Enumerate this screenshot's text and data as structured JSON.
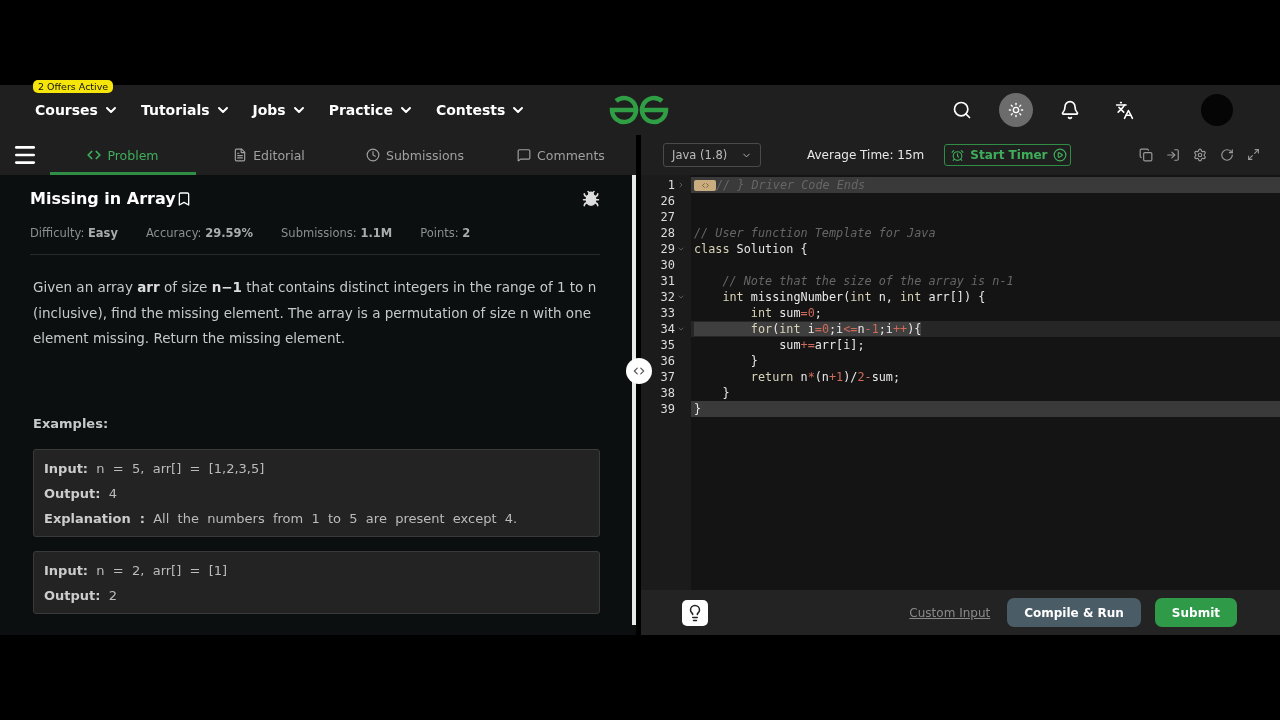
{
  "header": {
    "badge": "2 Offers Active",
    "nav": [
      {
        "label": "Courses"
      },
      {
        "label": "Tutorials"
      },
      {
        "label": "Jobs"
      },
      {
        "label": "Practice"
      },
      {
        "label": "Contests"
      }
    ],
    "theme_toggle": {
      "on": true
    }
  },
  "left_tabs": [
    {
      "label": "Problem",
      "selected": true
    },
    {
      "label": "Editorial",
      "selected": false
    },
    {
      "label": "Submissions",
      "selected": false
    },
    {
      "label": "Comments",
      "selected": false
    }
  ],
  "problem": {
    "title": "Missing in Array",
    "meta": [
      "Difficulty: **Easy**",
      "Accuracy: **29.59%**",
      "Submissions: **1.1M**",
      "Points: **2**"
    ],
    "description": "Given an array **arr** of size **n−1** that contains distinct integers in the range of 1 to n (inclusive), find the missing element. The array is a permutation of size n with one element missing. Return the missing element.",
    "examples_heading": "Examples:",
    "examples": [
      {
        "lines": [
          "**Input:**  n  =  5,  arr[]  =  [1,2,3,5]",
          "**Output:**  4",
          "**Explanation  :**  All  the  numbers  from  1  to  5  are  present  except  4."
        ]
      },
      {
        "lines": [
          "**Input:**  n  =  2,  arr[]  =  [1]",
          "**Output:**  2"
        ]
      }
    ]
  },
  "editor_toolbar": {
    "language": "Java (1.8)",
    "average_time": "Average Time: 15m",
    "timer_button": "Start Timer"
  },
  "code": [
    {
      "number": "1",
      "foldable": true,
      "collapsed": true,
      "highlighted": true,
      "selected": false,
      "tokens": [
        {
          "kind": "comment",
          "text": "// } Driver Code Ends"
        }
      ]
    },
    {
      "number": "26",
      "foldable": false,
      "collapsed": false,
      "highlighted": false,
      "selected": false
    },
    {
      "number": "27",
      "foldable": false,
      "collapsed": false,
      "highlighted": false,
      "selected": false
    },
    {
      "number": "28",
      "foldable": false,
      "collapsed": false,
      "highlighted": false,
      "selected": false,
      "tokens": [
        {
          "kind": "comment",
          "text": "// User function Template for Java"
        }
      ]
    },
    {
      "number": "29",
      "foldable": true,
      "collapsed": false,
      "highlighted": false,
      "selected": false,
      "tokens": [
        {
          "kind": "kw",
          "text": "class"
        },
        {
          "kind": "plain",
          "text": " Solution {"
        }
      ]
    },
    {
      "number": "30",
      "foldable": false,
      "collapsed": false,
      "highlighted": false,
      "selected": false
    },
    {
      "number": "31",
      "foldable": false,
      "collapsed": false,
      "highlighted": false,
      "selected": false,
      "tokens": [
        {
          "kind": "comment",
          "text": "    // Note that the size of the array is n-1"
        }
      ]
    },
    {
      "number": "32",
      "foldable": true,
      "collapsed": false,
      "highlighted": false,
      "selected": false,
      "tokens": [
        {
          "kind": "kw",
          "text": "    int"
        },
        {
          "kind": "plain",
          "text": " missingNumber("
        },
        {
          "kind": "kw",
          "text": "int"
        },
        {
          "kind": "plain",
          "text": " n, "
        },
        {
          "kind": "kw",
          "text": "int"
        },
        {
          "kind": "plain",
          "text": " arr[]) {"
        }
      ]
    },
    {
      "number": "33",
      "foldable": false,
      "collapsed": false,
      "highlighted": false,
      "selected": false,
      "tokens": [
        {
          "kind": "kw",
          "text": "        int"
        },
        {
          "kind": "plain",
          "text": " sum"
        },
        {
          "kind": "op",
          "text": "="
        },
        {
          "kind": "num",
          "text": "0"
        },
        {
          "kind": "plain",
          "text": ";"
        }
      ]
    },
    {
      "number": "34",
      "foldable": true,
      "collapsed": false,
      "highlighted": false,
      "selected": true,
      "tokens": [
        {
          "kind": "kw",
          "text": "        for"
        },
        {
          "kind": "plain",
          "text": "("
        },
        {
          "kind": "kw",
          "text": "int"
        },
        {
          "kind": "plain",
          "text": " i"
        },
        {
          "kind": "op",
          "text": "="
        },
        {
          "kind": "num",
          "text": "0"
        },
        {
          "kind": "plain",
          "text": ";i"
        },
        {
          "kind": "op",
          "text": "<="
        },
        {
          "kind": "plain",
          "text": "n"
        },
        {
          "kind": "op",
          "text": "-"
        },
        {
          "kind": "num",
          "text": "1"
        },
        {
          "kind": "plain",
          "text": ";i"
        },
        {
          "kind": "op",
          "text": "++"
        },
        {
          "kind": "plain",
          "text": "){"
        }
      ]
    },
    {
      "number": "35",
      "foldable": false,
      "collapsed": false,
      "highlighted": false,
      "selected": false,
      "tokens": [
        {
          "kind": "plain",
          "text": "            sum"
        },
        {
          "kind": "op",
          "text": "+="
        },
        {
          "kind": "plain",
          "text": "arr[i];"
        }
      ]
    },
    {
      "number": "36",
      "foldable": false,
      "collapsed": false,
      "highlighted": false,
      "selected": false,
      "tokens": [
        {
          "kind": "plain",
          "text": "        }"
        }
      ]
    },
    {
      "number": "37",
      "foldable": false,
      "collapsed": false,
      "highlighted": false,
      "selected": false,
      "tokens": [
        {
          "kind": "kw",
          "text": "        return"
        },
        {
          "kind": "plain",
          "text": " n"
        },
        {
          "kind": "op",
          "text": "*"
        },
        {
          "kind": "plain",
          "text": "(n"
        },
        {
          "kind": "op",
          "text": "+"
        },
        {
          "kind": "num",
          "text": "1"
        },
        {
          "kind": "plain",
          "text": ")/"
        },
        {
          "kind": "num",
          "text": "2"
        },
        {
          "kind": "op",
          "text": "-"
        },
        {
          "kind": "plain",
          "text": "sum;"
        }
      ]
    },
    {
      "number": "38",
      "foldable": false,
      "collapsed": false,
      "highlighted": false,
      "selected": false,
      "tokens": [
        {
          "kind": "plain",
          "text": "    }"
        }
      ]
    },
    {
      "number": "39",
      "foldable": false,
      "collapsed": false,
      "highlighted": true,
      "selected": false,
      "tokens": [
        {
          "kind": "plain",
          "text": "}"
        }
      ]
    }
  ],
  "editor_footer": {
    "custom_input": "Custom Input",
    "compile_button": "Compile & Run",
    "submit_button": "Submit"
  }
}
